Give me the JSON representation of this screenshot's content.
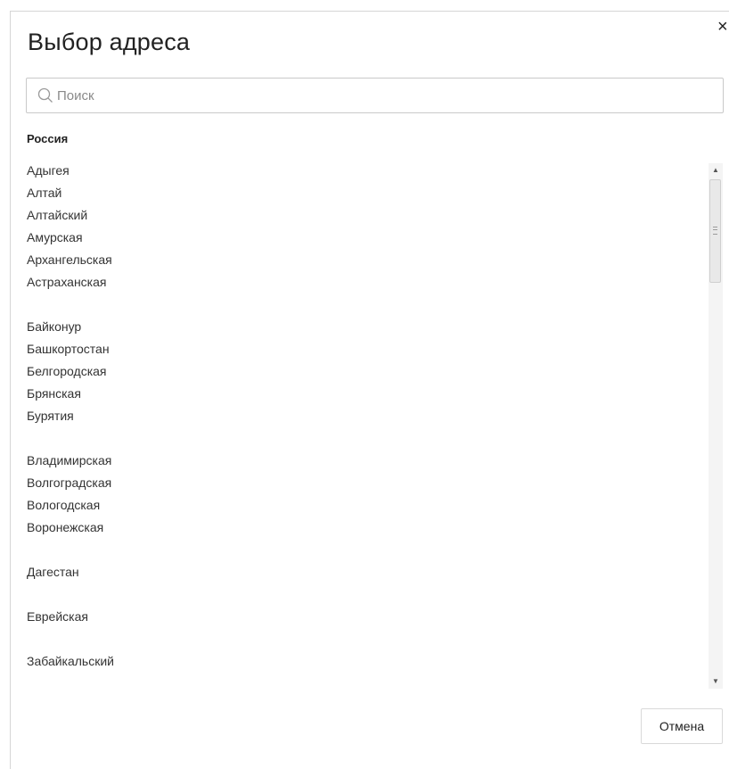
{
  "dialog": {
    "title": "Выбор адреса",
    "close_symbol": "×"
  },
  "search": {
    "placeholder": "Поиск",
    "value": "",
    "icon": "search-icon"
  },
  "country": "Россия",
  "groups": [
    [
      "Адыгея",
      "Алтай",
      "Алтайский",
      "Амурская",
      "Архангельская",
      "Астраханская"
    ],
    [
      "Байконур",
      "Башкортостан",
      "Белгородская",
      "Брянская",
      "Бурятия"
    ],
    [
      "Владимирская",
      "Волгоградская",
      "Вологодская",
      "Воронежская"
    ],
    [
      "Дагестан"
    ],
    [
      "Еврейская"
    ],
    [
      "Забайкальский"
    ]
  ],
  "scrollbar": {
    "up_symbol": "▲",
    "down_symbol": "▼"
  },
  "footer": {
    "cancel_label": "Отмена"
  }
}
